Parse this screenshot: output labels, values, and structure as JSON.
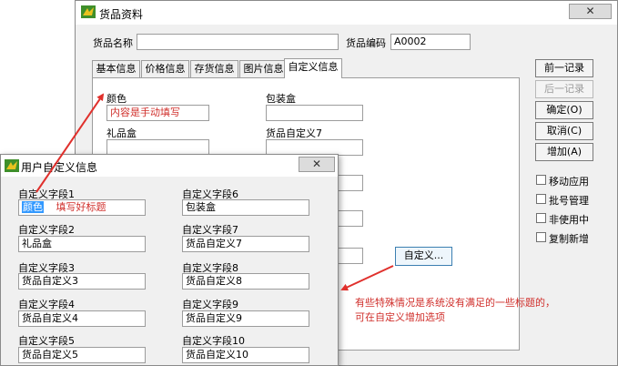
{
  "main_window": {
    "title": "货品资料",
    "close_label": "✕",
    "name_label": "货品名称",
    "name_value": "",
    "code_label": "货品编码",
    "code_value": "A0002",
    "tabs": [
      {
        "label": "基本信息"
      },
      {
        "label": "价格信息"
      },
      {
        "label": "存货信息"
      },
      {
        "label": "图片信息"
      },
      {
        "label": "自定义信息"
      }
    ],
    "fields": {
      "color_label": "颜色",
      "color_value": "内容是手动填写",
      "package_label": "包装盒",
      "package_value": "",
      "giftbox_label": "礼品盒",
      "giftbox_value": "",
      "custom7_label": "货品自定义7",
      "custom7_value": ""
    },
    "custom_button": "自定义...",
    "side_buttons": {
      "prev": "前一记录",
      "next": "后一记录",
      "ok": "确定(O)",
      "cancel": "取消(C)",
      "add": "增加(A)"
    },
    "checkboxes": [
      "移动应用",
      "批号管理",
      "非使用中",
      "复制新增"
    ]
  },
  "dialog": {
    "title": "用户自定义信息",
    "close_label": "✕",
    "left_fields": [
      {
        "label": "自定义字段1",
        "value_selected": "颜色",
        "value_hint": "填写好标题"
      },
      {
        "label": "自定义字段2",
        "value": "礼品盒"
      },
      {
        "label": "自定义字段3",
        "value": "货品自定义3"
      },
      {
        "label": "自定义字段4",
        "value": "货品自定义4"
      },
      {
        "label": "自定义字段5",
        "value": "货品自定义5"
      }
    ],
    "right_fields": [
      {
        "label": "自定义字段6",
        "value": "包装盒"
      },
      {
        "label": "自定义字段7",
        "value": "货品自定义7"
      },
      {
        "label": "自定义字段8",
        "value": "货品自定义8"
      },
      {
        "label": "自定义字段9",
        "value": "货品自定义9"
      },
      {
        "label": "自定义字段10",
        "value": "货品自定义10"
      }
    ]
  },
  "annotation": {
    "line1": "有些特殊情况是系统没有满足的一些标题的，",
    "line2": "可在自定义增加选项",
    "color": "#d0302c"
  }
}
